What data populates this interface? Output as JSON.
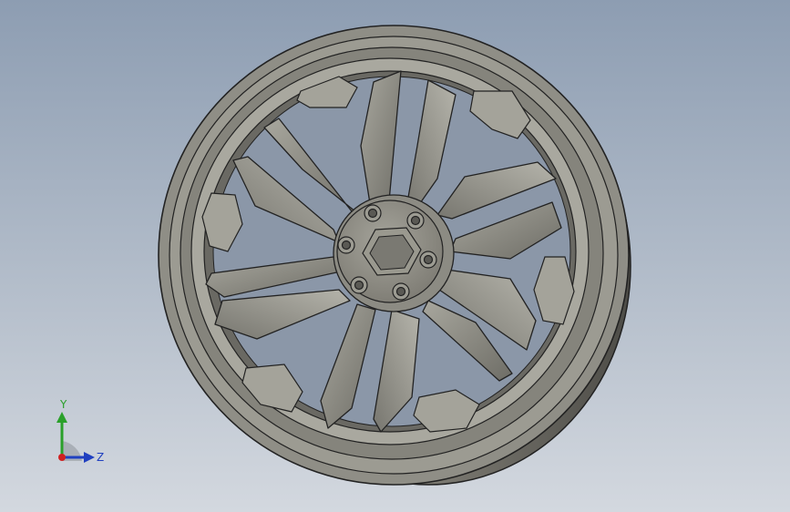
{
  "viewport": {
    "background_top": "#8d9db2",
    "background_bottom": "#d3d8df",
    "model_name": "wheel-rim",
    "model_color": "#8a8880"
  },
  "triad": {
    "y_label": "Y",
    "z_label": "Z",
    "y_color": "#2aa02a",
    "z_color": "#2040c0",
    "x_color": "#d02020"
  }
}
